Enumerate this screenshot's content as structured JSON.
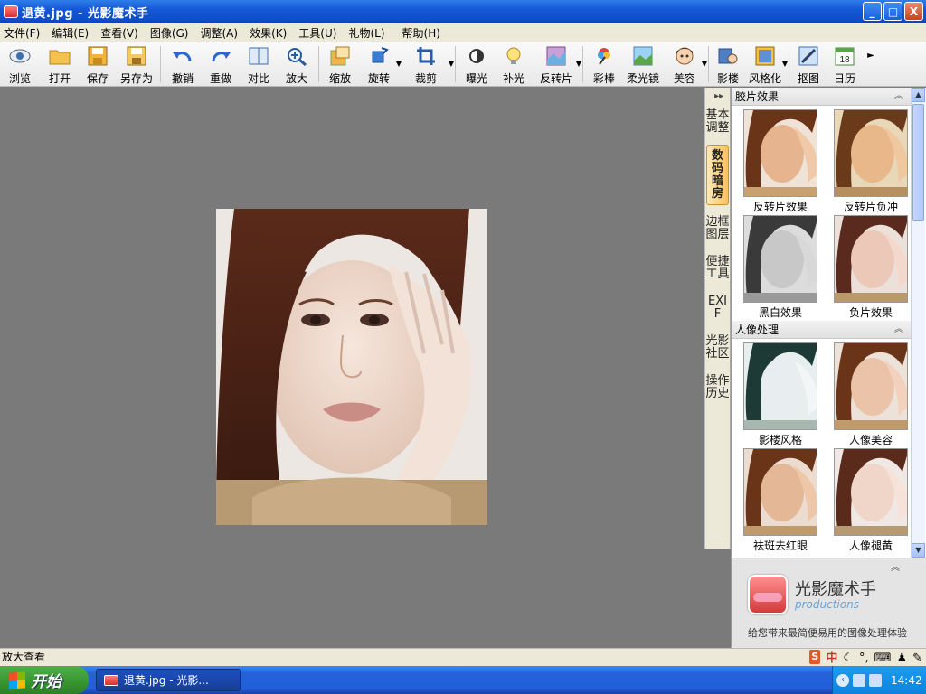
{
  "window": {
    "title": "退黄.jpg - 光影魔术手",
    "buttons": {
      "minimize": "_",
      "maximize": "□",
      "close": "X"
    }
  },
  "menu": [
    "文件(F)",
    "编辑(E)",
    "查看(V)",
    "图像(G)",
    "调整(A)",
    "效果(K)",
    "工具(U)",
    "礼物(L)",
    "帮助(H)"
  ],
  "toolbar": [
    {
      "label": "浏览",
      "icon": "eye-icon"
    },
    {
      "label": "打开",
      "icon": "folder-icon"
    },
    {
      "label": "保存",
      "icon": "save-icon"
    },
    {
      "label": "另存为",
      "icon": "save-as-icon"
    },
    {
      "label": "撤销",
      "icon": "undo-icon"
    },
    {
      "label": "重做",
      "icon": "redo-icon"
    },
    {
      "label": "对比",
      "icon": "compare-icon"
    },
    {
      "label": "放大",
      "icon": "zoom-in-icon"
    },
    {
      "label": "缩放",
      "icon": "resize-icon"
    },
    {
      "label": "旋转",
      "icon": "rotate-icon"
    },
    {
      "label": "裁剪",
      "icon": "crop-icon"
    },
    {
      "label": "曝光",
      "icon": "exposure-icon"
    },
    {
      "label": "补光",
      "icon": "fill-light-icon"
    },
    {
      "label": "反转片",
      "icon": "reversal-film-icon"
    },
    {
      "label": "彩棒",
      "icon": "color-wand-icon"
    },
    {
      "label": "柔光镜",
      "icon": "soft-lens-icon"
    },
    {
      "label": "美容",
      "icon": "beauty-icon"
    },
    {
      "label": "影楼",
      "icon": "studio-icon"
    },
    {
      "label": "风格化",
      "icon": "stylize-icon"
    },
    {
      "label": "抠图",
      "icon": "cutout-icon"
    },
    {
      "label": "日历",
      "icon": "calendar-icon"
    }
  ],
  "calendar_day": "18",
  "side_tabs": [
    "基本调整",
    "数码暗房",
    "边框图层",
    "便捷工具",
    "EXIF",
    "光影社区",
    "操作历史"
  ],
  "active_side_tab": "数码暗房",
  "sections": [
    {
      "title": "胶片效果",
      "items": [
        "反转片效果",
        "反转片负冲",
        "黑白效果",
        "负片效果"
      ]
    },
    {
      "title": "人像处理",
      "items": [
        "影楼风格",
        "人像美容",
        "祛斑去红眼",
        "人像褪黄"
      ]
    }
  ],
  "brand": {
    "name": "光影魔术手",
    "sub": "productions",
    "slogan": "给您带来最简便易用的图像处理体验"
  },
  "status": {
    "text": "放大查看",
    "ime": "中"
  },
  "taskbar": {
    "start": "开始",
    "task": "退黄.jpg - 光影...",
    "clock": "14:42"
  }
}
